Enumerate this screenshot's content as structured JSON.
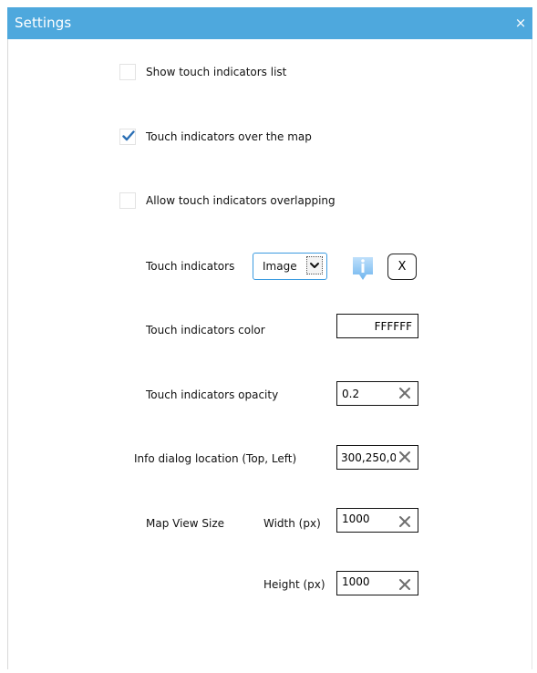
{
  "window": {
    "title": "Settings",
    "close_label": "×"
  },
  "checkboxes": [
    {
      "label": "Show touch indicators list",
      "checked": false
    },
    {
      "label": "Touch indicators over the map",
      "checked": true
    },
    {
      "label": "Allow touch indicators overlapping",
      "checked": false
    }
  ],
  "touch_indicators": {
    "label": "Touch indicators",
    "select_value": "Image",
    "info_icon": "info-icon",
    "clear_button_label": "X"
  },
  "color": {
    "label": "Touch indicators color",
    "value": "FFFFFF"
  },
  "opacity": {
    "label": "Touch indicators opacity",
    "value": "0.2"
  },
  "info_dialog": {
    "label": "Info dialog location (Top, Left)",
    "value": "300,250,0"
  },
  "map_view": {
    "label": "Map View Size",
    "width_label": "Width (px)",
    "width_value": "1000",
    "height_label": "Height (px)",
    "height_value": "1000"
  },
  "colors": {
    "title_bar": "#4ea8dd",
    "accent": "#3c9be0",
    "check": "#2b6fb5"
  }
}
